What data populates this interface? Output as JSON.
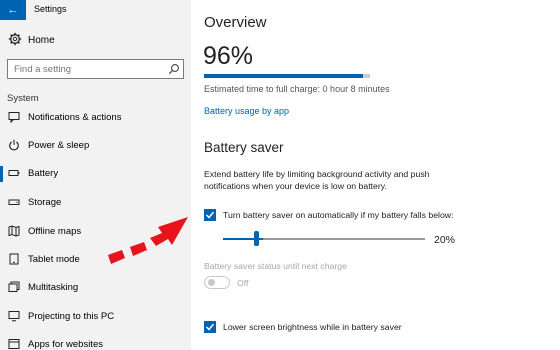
{
  "window": {
    "title": "Settings",
    "back_glyph": "←"
  },
  "sidebar": {
    "home_label": "Home",
    "search_placeholder": "Find a setting",
    "section_label": "System",
    "items": [
      {
        "label": "Notifications & actions",
        "icon": "notifications-icon"
      },
      {
        "label": "Power & sleep",
        "icon": "power-icon"
      },
      {
        "label": "Battery",
        "icon": "battery-icon",
        "active": true
      },
      {
        "label": "Storage",
        "icon": "storage-icon"
      },
      {
        "label": "Offline maps",
        "icon": "map-icon"
      },
      {
        "label": "Tablet mode",
        "icon": "tablet-icon"
      },
      {
        "label": "Multitasking",
        "icon": "multitasking-icon"
      },
      {
        "label": "Projecting to this PC",
        "icon": "projecting-icon"
      },
      {
        "label": "Apps for websites",
        "icon": "apps-websites-icon"
      }
    ]
  },
  "overview": {
    "title": "Overview",
    "percent": "96%",
    "charge_level": 0.96,
    "estimate": "Estimated time to full charge: 0 hour 8 minutes",
    "usage_link": "Battery usage by app"
  },
  "battery_saver": {
    "title": "Battery saver",
    "description": "Extend battery life by limiting background activity and push notifications when your device is low on battery.",
    "auto_checkbox_label": "Turn battery saver on automatically if my battery falls below:",
    "auto_checked": true,
    "threshold_value": "20%",
    "threshold_level": 0.2,
    "status_label": "Battery saver status until next charge",
    "status_toggle_label": "Off",
    "status_toggle_on": false,
    "brightness_checkbox_label": "Lower screen brightness while in battery saver",
    "brightness_checked": true
  },
  "colors": {
    "accent": "#0063b1",
    "annotation_arrow": "#e8141c"
  }
}
